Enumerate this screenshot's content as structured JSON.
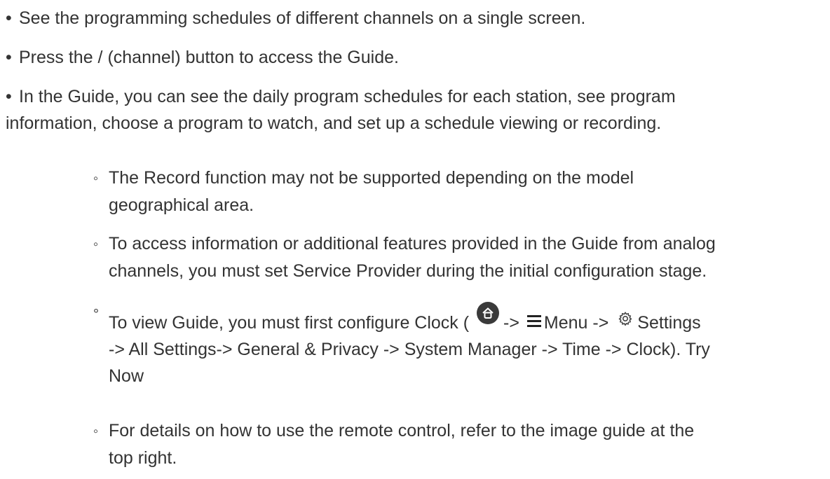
{
  "bullets": [
    "See the programming schedules of different channels on a single screen.",
    "Press the / (channel) button to access the Guide.",
    {
      "line1": "In the Guide, you can see the daily program schedules for each station, see program",
      "line2": "information, choose a program to watch, and set up a schedule viewing or recording."
    }
  ],
  "bullet_symbol": "•",
  "sub_symbol": "◦",
  "sup_symbol": "°",
  "notes": {
    "record": {
      "line1": "The Record function may not be supported depending on the model",
      "line2": "geographical area."
    },
    "analog": {
      "line1": "To access information or additional features provided in the Guide from analog",
      "line2": "channels, you must set Service Provider during the initial configuration stage."
    },
    "clock": {
      "part1": "To view Guide, you must first configure Clock (",
      "arrow1": "->",
      "menu_label": "Menu ->",
      "settings_label": "Settings",
      "line2": "-> All Settings-> General & Privacy -> System Manager -> Time -> Clock). Try",
      "line3": "Now"
    },
    "remote": {
      "line1": "For details on how to use the remote control, refer to the image guide at the",
      "line2": "top right."
    }
  },
  "icons": {
    "home": "home-icon",
    "menu": "menu-icon",
    "settings": "gear-icon"
  }
}
